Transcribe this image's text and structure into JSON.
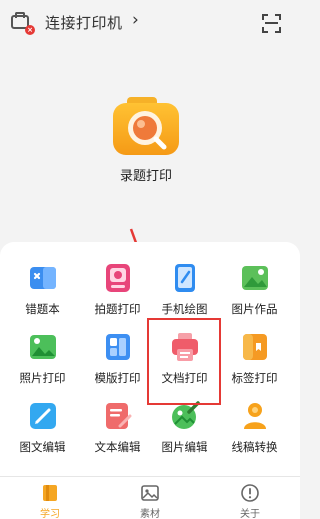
{
  "header": {
    "connect_label": "连接打印机",
    "chevron": "›",
    "printer_badge": "×"
  },
  "hero": {
    "label": "录题打印",
    "icon": "camera-search-icon"
  },
  "features": [
    {
      "label": "错题本",
      "icon": "wrong-question-book-icon"
    },
    {
      "label": "拍题打印",
      "icon": "photo-question-print-icon"
    },
    {
      "label": "手机绘图",
      "icon": "phone-drawing-icon"
    },
    {
      "label": "图片作品",
      "icon": "picture-works-icon"
    },
    {
      "label": "照片打印",
      "icon": "photo-print-icon"
    },
    {
      "label": "模版打印",
      "icon": "template-print-icon"
    },
    {
      "label": "文档打印",
      "icon": "document-print-icon"
    },
    {
      "label": "标签打印",
      "icon": "label-print-icon"
    },
    {
      "label": "图文编辑",
      "icon": "image-text-edit-icon"
    },
    {
      "label": "文本编辑",
      "icon": "text-edit-icon"
    },
    {
      "label": "图片编辑",
      "icon": "image-edit-icon"
    },
    {
      "label": "线稿转换",
      "icon": "line-art-convert-icon"
    }
  ],
  "nav": {
    "tabs": [
      {
        "label": "学习",
        "icon": "book-icon",
        "active": true
      },
      {
        "label": "素材",
        "icon": "image-icon",
        "active": false
      },
      {
        "label": "关于",
        "icon": "info-icon",
        "active": false
      }
    ]
  },
  "colors": {
    "accent_orange": "#f5a623",
    "highlight_red": "#e53935",
    "inactive_gray": "#666666"
  }
}
